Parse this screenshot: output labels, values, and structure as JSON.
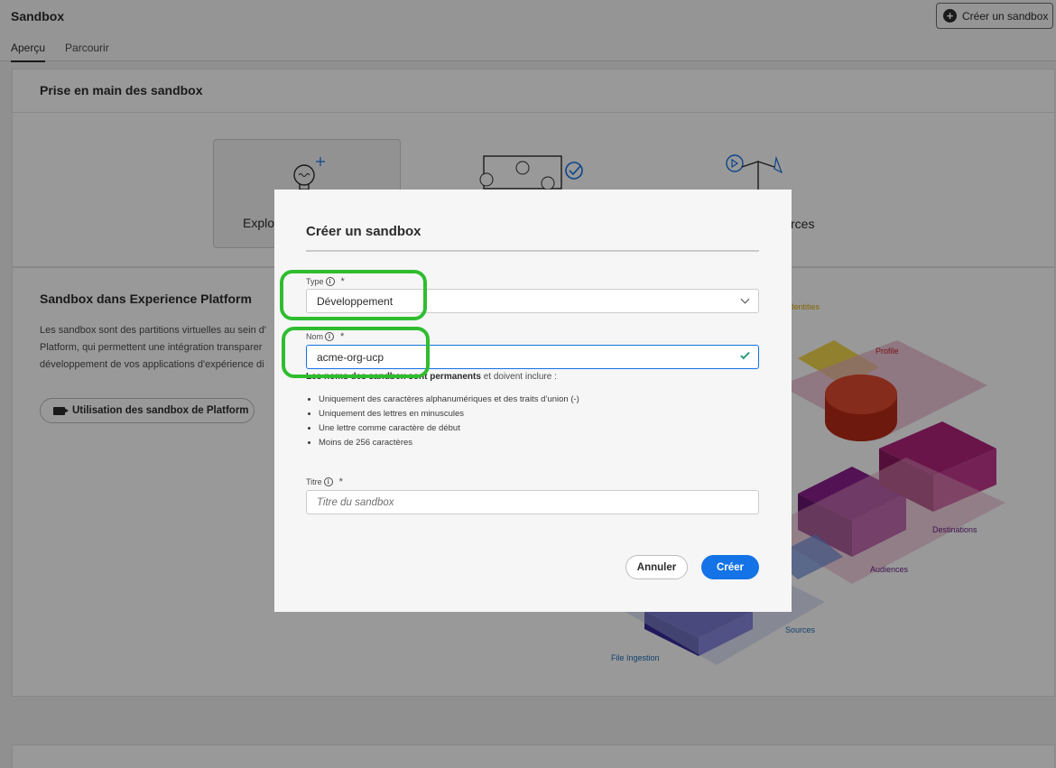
{
  "header": {
    "app_title": "Sandbox",
    "create_button": "Créer un sandbox"
  },
  "tabs": [
    {
      "label": "Aperçu",
      "active": true
    },
    {
      "label": "Parcourir",
      "active": false
    }
  ],
  "getting_started": {
    "title": "Prise en main des sandbox",
    "tile1_label": "Explo",
    "tile3_label": "rces"
  },
  "about": {
    "title": "Sandbox dans Experience Platform",
    "lines": [
      "Les sandbox sont des partitions virtuelles au sein d'",
      "Platform, qui permettent une intégration transparer",
      "développement de vos applications d'expérience di"
    ],
    "video_button": "Utilisation des sandbox de Platform"
  },
  "illustration_labels": {
    "identities": "Identities",
    "profile": "Profile",
    "destinations": "Destinations",
    "audiences": "Audiences",
    "sources": "Sources",
    "file_ingestion": "File Ingestion"
  },
  "dialog": {
    "title": "Créer un sandbox",
    "type_label": "Type",
    "type_value": "Développement",
    "name_label": "Nom",
    "name_value": "acme-org-ucp",
    "help_bold": "Les noms des sandbox sont permanents",
    "help_rest": " et doivent inclure :",
    "rules": [
      "Uniquement des caractères alphanumériques et des traits d’union (-)",
      "Uniquement des lettres en minuscules",
      "Une lettre comme caractère de début",
      "Moins de 256 caractères"
    ],
    "title_label": "Titre",
    "title_placeholder": "Titre du sandbox",
    "cancel": "Annuler",
    "create": "Créer",
    "required_mark": "*",
    "info_glyph": "i"
  },
  "colors": {
    "accent": "#1473e6",
    "highlight": "#2fbd2f",
    "valid": "#2d9d78"
  }
}
